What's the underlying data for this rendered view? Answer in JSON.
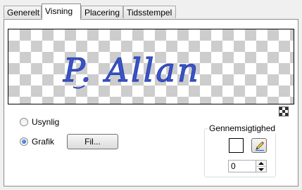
{
  "tabs": [
    {
      "label": "Generelt"
    },
    {
      "label": "Visning"
    },
    {
      "label": "Placering"
    },
    {
      "label": "Tidsstempel"
    }
  ],
  "active_tab": "Visning",
  "preview": {
    "signature_text": "P. Allan",
    "signature_color": "#3b55c8"
  },
  "options": {
    "invisible_label": "Usynlig",
    "graphic_label": "Grafik",
    "selected": "Grafik"
  },
  "file_button": {
    "label": "Fil..."
  },
  "transparency": {
    "title": "Gennemsigtighed",
    "color": "#ffffff",
    "value": "0"
  }
}
